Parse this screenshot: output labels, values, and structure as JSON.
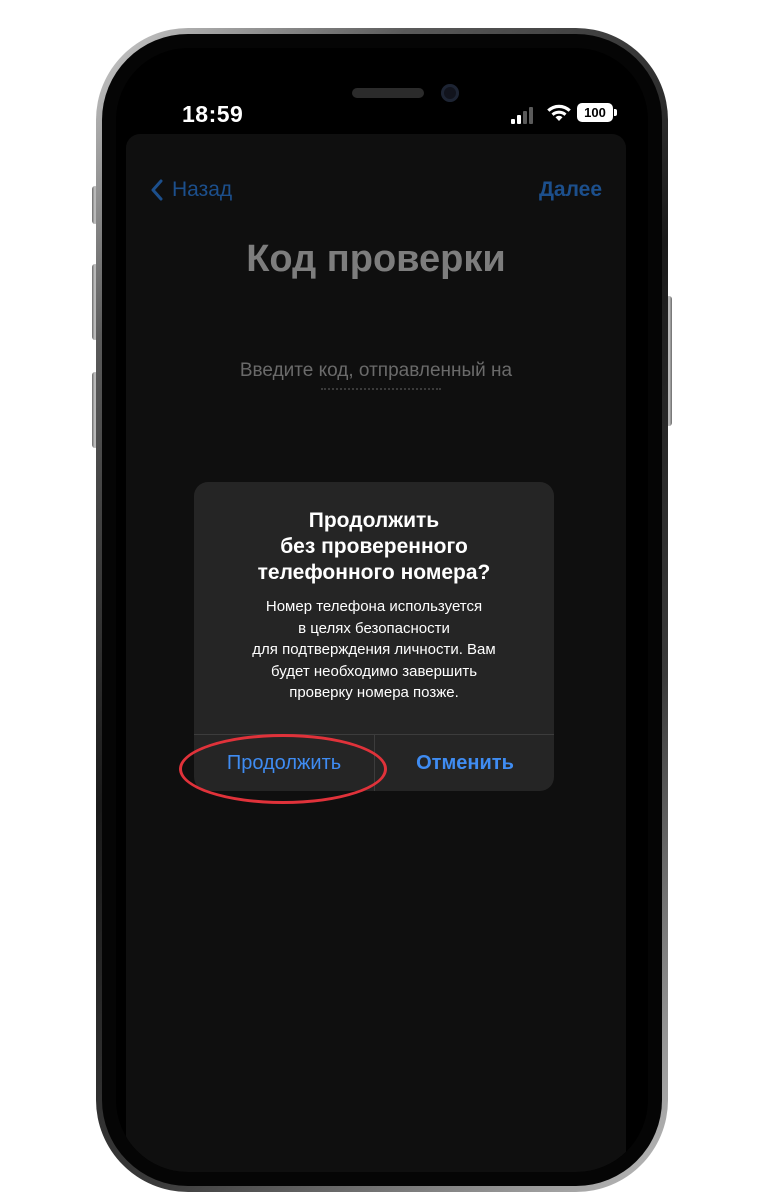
{
  "status_bar": {
    "time": "18:59",
    "battery": "100"
  },
  "nav": {
    "back_label": "Назад",
    "next_label": "Далее"
  },
  "page": {
    "title": "Код проверки",
    "subtitle": "Введите код, отправленный на"
  },
  "alert": {
    "title_lines": [
      "Продолжить",
      "без проверенного",
      "телефонного номера?"
    ],
    "message_lines": [
      "Номер телефона используется",
      "в целях безопасности",
      "для подтверждения личности. Вам",
      "будет необходимо завершить",
      "проверку номера позже."
    ],
    "continue_label": "Продолжить",
    "cancel_label": "Отменить"
  },
  "colors": {
    "accent": "#3f8cf2",
    "highlight": "#e0323a",
    "alert_bg": "#252525"
  }
}
